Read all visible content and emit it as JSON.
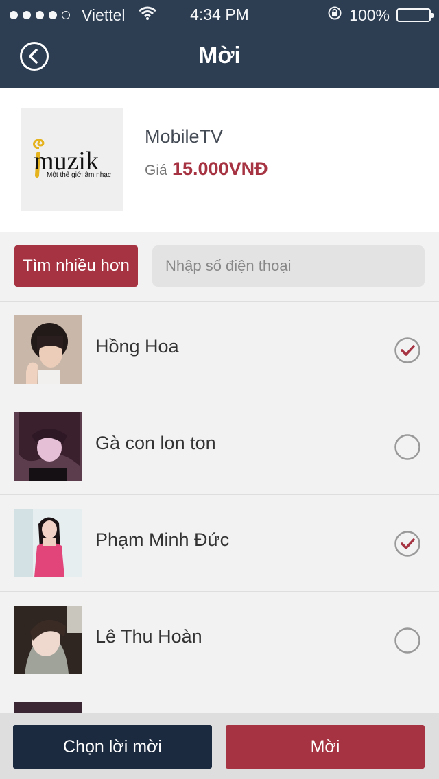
{
  "status_bar": {
    "carrier": "Viettel",
    "time": "4:34 PM",
    "battery": "100%",
    "signal_dots": [
      true,
      true,
      true,
      true,
      false
    ]
  },
  "header": {
    "title": "Mời",
    "back_icon": "back-arrow-icon"
  },
  "product": {
    "logo_text": "muzik",
    "logo_tagline": "Một thế giới âm nhạc",
    "name": "MobileTV",
    "price_label": "Giá",
    "price_value": "15.000VNĐ"
  },
  "search": {
    "more_button": "Tìm nhiều hơn",
    "phone_placeholder": "Nhập số điện thoại"
  },
  "contacts": [
    {
      "name": "Hồng Hoa",
      "checked": true
    },
    {
      "name": "Gà con lon ton",
      "checked": false
    },
    {
      "name": "Phạm Minh Đức",
      "checked": true
    },
    {
      "name": "Lê Thu Hoàn",
      "checked": false
    }
  ],
  "bottom": {
    "choose_message": "Chọn lời mời",
    "invite": "Mời"
  },
  "colors": {
    "header_bg": "#2d3e53",
    "accent": "#a63342",
    "dark_button": "#1c2a40"
  }
}
